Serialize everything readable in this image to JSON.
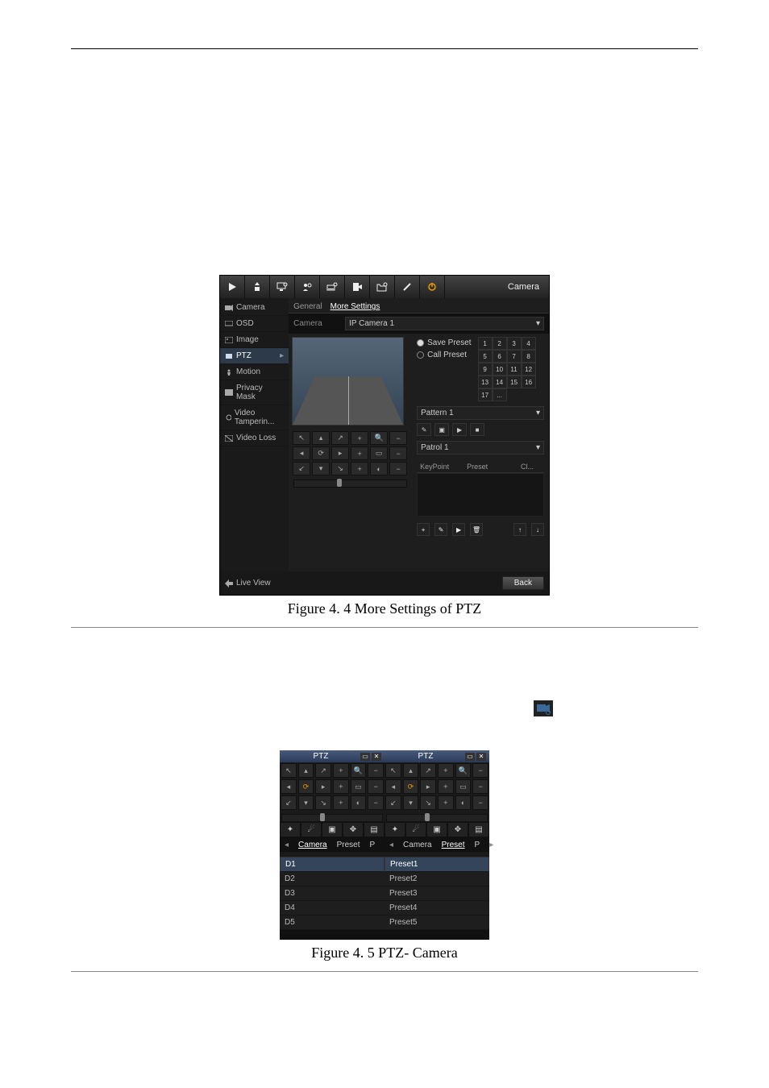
{
  "figure_a": {
    "topbar_label": "Camera",
    "sidebar": [
      "Camera",
      "OSD",
      "Image",
      "PTZ",
      "Motion",
      "Privacy Mask",
      "Video Tamperin...",
      "Video Loss"
    ],
    "sidebar_active_index": 3,
    "tabs": {
      "general": "General",
      "more": "More Settings"
    },
    "camera_label": "Camera",
    "camera_value": "IP Camera 1",
    "save_preset": "Save Preset",
    "call_preset": "Call Preset",
    "preset_numbers": [
      "1",
      "2",
      "3",
      "4",
      "5",
      "6",
      "7",
      "8",
      "9",
      "10",
      "11",
      "12",
      "13",
      "14",
      "15",
      "16",
      "17",
      "..."
    ],
    "pattern_label": "Pattern 1",
    "patrol_label": "Patrol 1",
    "table_headers": {
      "keypoint": "KeyPoint",
      "preset": "Preset",
      "cl": "Cl..."
    },
    "live_view": "Live View",
    "back": "Back",
    "caption": "Figure 4. 4  More Settings of PTZ"
  },
  "figure_b": {
    "panel_title": "PTZ",
    "tab_camera": "Camera",
    "tab_preset": "Preset",
    "p_marker": "P",
    "camera_items": [
      "D1",
      "D2",
      "D3",
      "D4",
      "D5"
    ],
    "preset_items": [
      "Preset1",
      "Preset2",
      "Preset3",
      "Preset4",
      "Preset5"
    ],
    "caption": "Figure 4. 5  PTZ- Camera"
  }
}
